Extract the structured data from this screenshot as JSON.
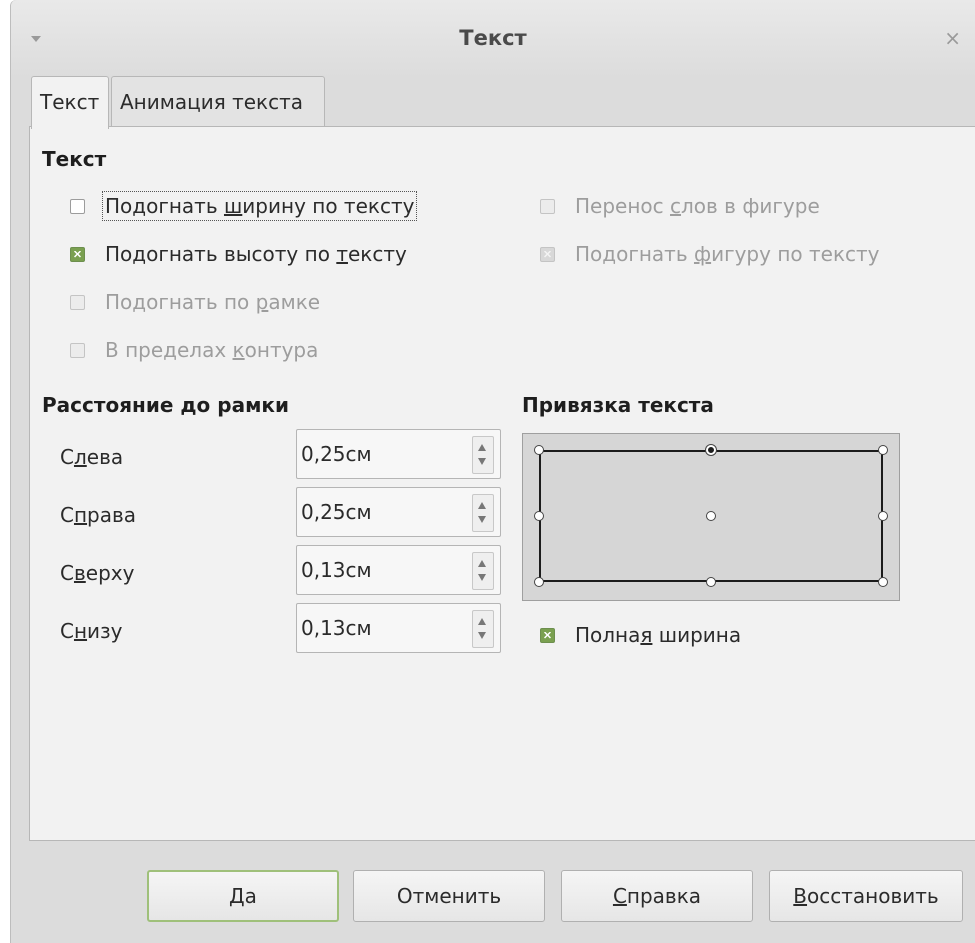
{
  "window": {
    "title": "Текст"
  },
  "tabs": [
    {
      "label": "Текст"
    },
    {
      "label": "Анимация текста"
    }
  ],
  "text_section": {
    "title": "Текст",
    "checkboxes": {
      "fit_width": {
        "before": "Подогнать ",
        "mnemonic": "ш",
        "after": "ирину по тексту",
        "checked": false,
        "enabled": true
      },
      "fit_height": {
        "before": "Подогнать высоту по ",
        "mnemonic": "т",
        "after": "ексту",
        "checked": true,
        "enabled": true
      },
      "fit_frame": {
        "before": "Подогнать по ",
        "mnemonic": "р",
        "after": "амке",
        "checked": false,
        "enabled": false
      },
      "contour": {
        "before": "В пределах ",
        "mnemonic": "к",
        "after": "онтура",
        "checked": false,
        "enabled": false
      },
      "word_wrap": {
        "before": "Перенос ",
        "mnemonic": "с",
        "after": "лов в фигуре",
        "checked": false,
        "enabled": false
      },
      "fit_shape": {
        "before": "Подогнать ",
        "mnemonic": "ф",
        "after": "игуру по тексту",
        "checked": true,
        "enabled": false
      }
    }
  },
  "spacing_section": {
    "title": "Расстояние до рамки",
    "fields": [
      {
        "pre": "С",
        "mnemonic": "л",
        "post": "ева",
        "value": "0,25см"
      },
      {
        "pre": "С",
        "mnemonic": "п",
        "post": "рава",
        "value": "0,25см"
      },
      {
        "pre": "С",
        "mnemonic": "в",
        "post": "ерху",
        "value": "0,13см"
      },
      {
        "pre": "С",
        "mnemonic": "н",
        "post": "изу",
        "value": "0,13см"
      }
    ]
  },
  "anchor_section": {
    "title": "Привязка текста",
    "selected": "top-center",
    "full_width": {
      "before": "Полна",
      "mnemonic": "я",
      "after": " ширина",
      "checked": true
    }
  },
  "buttons": {
    "ok": "Да",
    "cancel": "Отменить",
    "help": {
      "mnemonic": "С",
      "rest": "правка"
    },
    "reset": {
      "mnemonic": "В",
      "rest": "осстановить"
    }
  }
}
